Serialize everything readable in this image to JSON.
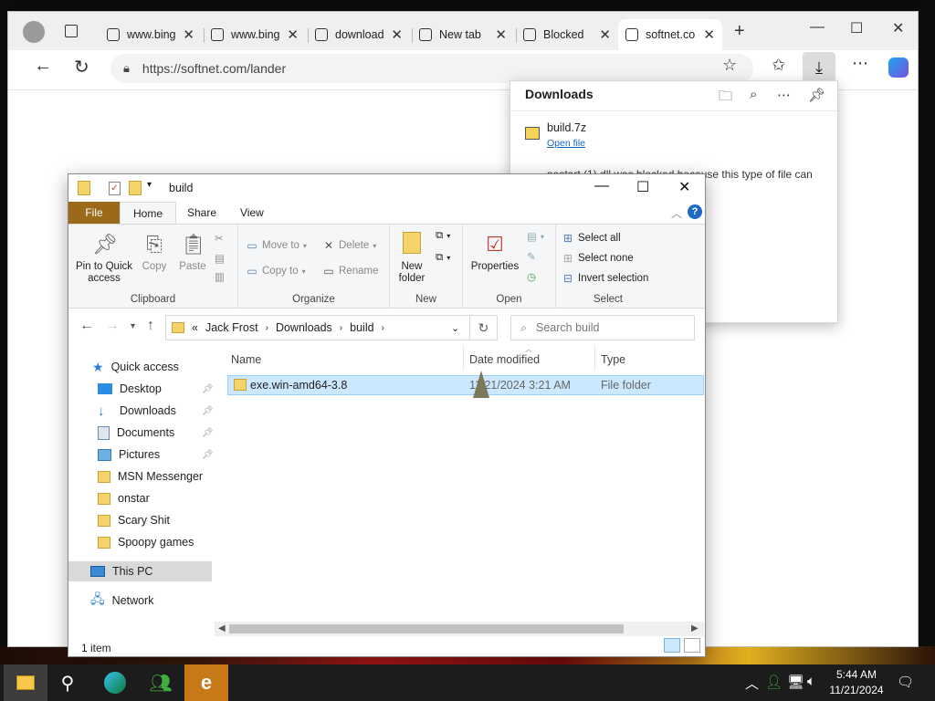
{
  "browser": {
    "tabs": [
      {
        "label": "www.bing",
        "active": false
      },
      {
        "label": "www.bing",
        "active": false
      },
      {
        "label": "download",
        "active": false
      },
      {
        "label": "New tab",
        "active": false
      },
      {
        "label": "Blocked",
        "active": false
      },
      {
        "label": "softnet.co",
        "active": true
      }
    ],
    "url": "https://softnet.com/lander",
    "downloads": {
      "title": "Downloads",
      "file_name": "build.7z",
      "open_label": "Open file",
      "blocked_text": "nostart (1).dll was blocked because this type of file can"
    }
  },
  "explorer": {
    "title": "build",
    "ribbon_tabs": {
      "file": "File",
      "home": "Home",
      "share": "Share",
      "view": "View"
    },
    "clipboard": {
      "pin": "Pin to Quick access",
      "copy": "Copy",
      "paste": "Paste",
      "label": "Clipboard"
    },
    "organize": {
      "move_to": "Move to",
      "copy_to": "Copy to",
      "delete": "Delete",
      "rename": "Rename",
      "label": "Organize"
    },
    "new": {
      "new_folder": "New folder",
      "label": "New"
    },
    "open": {
      "properties": "Properties",
      "label": "Open"
    },
    "select": {
      "select_all": "Select all",
      "select_none": "Select none",
      "invert": "Invert selection",
      "label": "Select"
    },
    "breadcrumb": {
      "prefix": "«",
      "parts": [
        "Jack Frost",
        "Downloads",
        "build"
      ]
    },
    "search_placeholder": "Search build",
    "nav": {
      "quick_access": "Quick access",
      "items": [
        "Desktop",
        "Downloads",
        "Documents",
        "Pictures",
        "MSN Messenger",
        "onstar",
        "Scary Shit",
        "Spoopy games"
      ],
      "this_pc": "This PC",
      "network": "Network"
    },
    "columns": {
      "name": "Name",
      "date": "Date modified",
      "type": "Type"
    },
    "files": [
      {
        "name": "exe.win-amd64-3.8",
        "date": "11/21/2024 3:21 AM",
        "type": "File folder"
      }
    ],
    "status": "1 item"
  },
  "taskbar": {
    "time": "5:44 AM",
    "date": "11/21/2024"
  }
}
